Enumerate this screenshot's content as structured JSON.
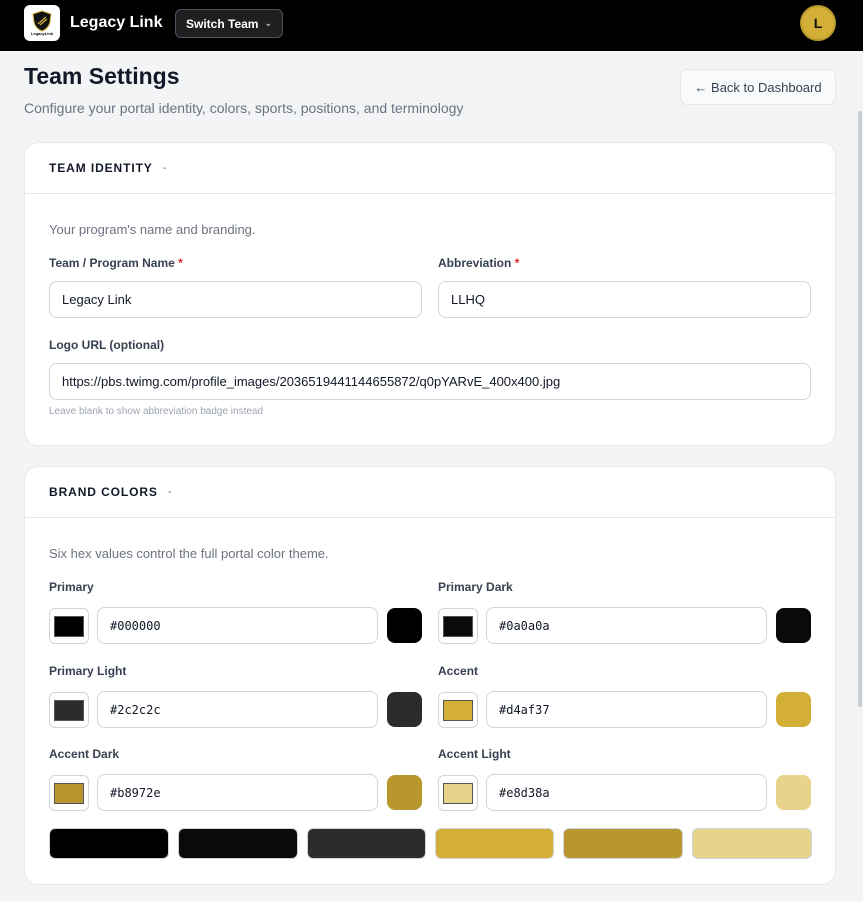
{
  "topbar": {
    "brand_name": "Legacy Link",
    "logo_mini_text": "LegacyLink",
    "switch_team_label": "Switch Team",
    "avatar_initial": "L"
  },
  "page": {
    "title": "Team Settings",
    "subtitle": "Configure your portal identity, colors, sports, positions, and terminology",
    "back_label": "← Back to Dashboard"
  },
  "identity": {
    "title": "TEAM IDENTITY",
    "collapse_symbol": "-",
    "description": "Your program's name and branding.",
    "name_label": "Team / Program Name",
    "name_value": "Legacy Link",
    "abbr_label": "Abbreviation",
    "abbr_value": "LLHQ",
    "required_mark": "*",
    "logo_label": "Logo URL (optional)",
    "logo_value": "https://pbs.twimg.com/profile_images/2036519441144655872/q0pYARvE_400x400.jpg",
    "logo_hint": "Leave blank to show abbreviation badge instead"
  },
  "brand": {
    "title": "BRAND COLORS",
    "collapse_symbol": "-",
    "description": "Six hex values control the full portal color theme.",
    "colors": [
      {
        "label": "Primary",
        "value": "#000000"
      },
      {
        "label": "Primary Dark",
        "value": "#0a0a0a"
      },
      {
        "label": "Primary Light",
        "value": "#2c2c2c"
      },
      {
        "label": "Accent",
        "value": "#d4af37"
      },
      {
        "label": "Accent Dark",
        "value": "#b8972e"
      },
      {
        "label": "Accent Light",
        "value": "#e8d38a"
      }
    ]
  }
}
